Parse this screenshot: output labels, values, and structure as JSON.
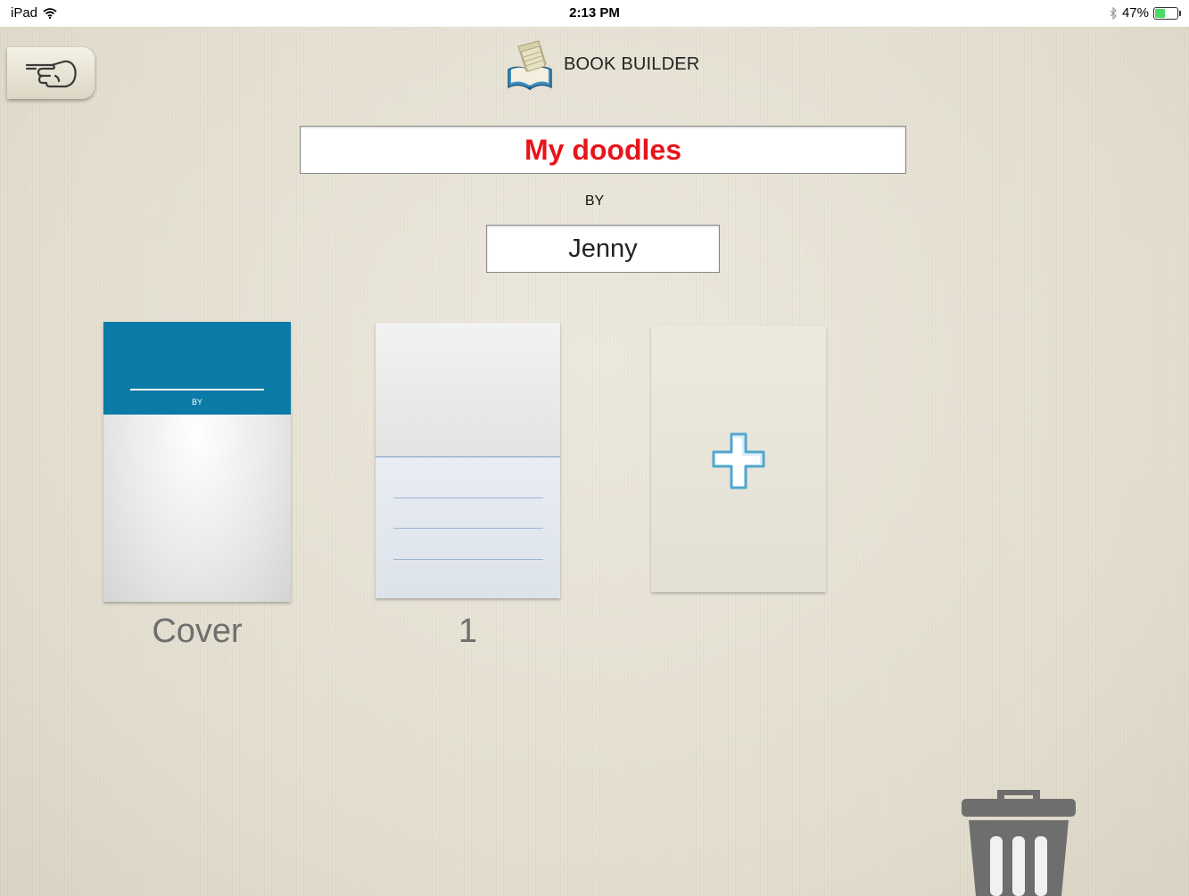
{
  "status_bar": {
    "device": "iPad",
    "time": "2:13 PM",
    "battery_percent": "47%",
    "battery_level": 0.47,
    "icons": [
      "wifi-icon",
      "bluetooth-icon",
      "battery-icon"
    ]
  },
  "header": {
    "app_title": "BOOK BUILDER",
    "back_icon": "pointing-hand-icon",
    "logo_icon": "open-book-icon"
  },
  "book": {
    "title": "My doodles",
    "by_label": "BY",
    "author": "Jenny"
  },
  "pages": [
    {
      "label": "Cover",
      "band_text": "BY"
    },
    {
      "label": "1"
    }
  ],
  "add_page": {
    "icon": "plus-icon"
  },
  "trash": {
    "icon": "trash-icon"
  },
  "colors": {
    "title_text": "#e8141b",
    "cover_band": "#0a7aa6",
    "plus_fill": "#ffffff",
    "plus_outline": "#4fa6cf",
    "trash": "#6e6e6e",
    "battery": "#4cd964"
  }
}
